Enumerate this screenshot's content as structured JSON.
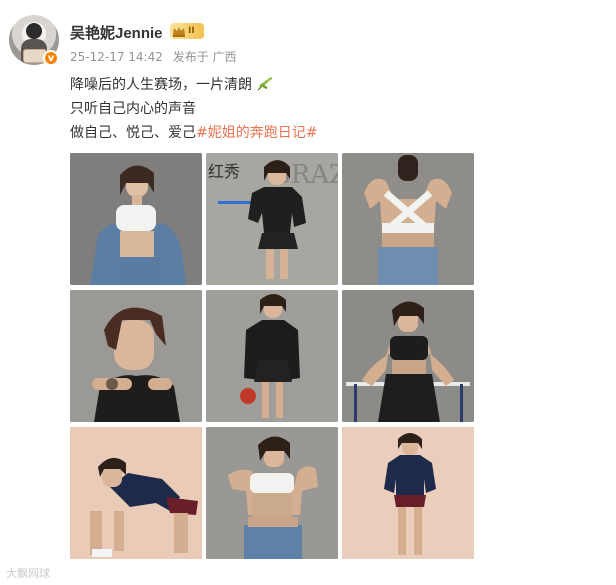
{
  "post": {
    "author": "吴艳妮Jennie",
    "member_level": "II",
    "verified_badge": "v",
    "timestamp": "25-12-17 14:42",
    "source": "发布于 广西",
    "lines": [
      "降噪后的人生赛场，一片清朗",
      "只听自己内心的声音"
    ],
    "line3_prefix": "做自己、悦己、爱己",
    "topic": "#妮姐的奔跑日记#",
    "photo_overlay_text": "红秀",
    "photo_overlay_brand": "GRAZIA",
    "accent_color": "#eb7350"
  },
  "watermark": "大飘网球",
  "icons": {
    "crown": "crown-icon",
    "leaf": "leaf-emoji-icon",
    "verified": "verified-v-icon"
  }
}
